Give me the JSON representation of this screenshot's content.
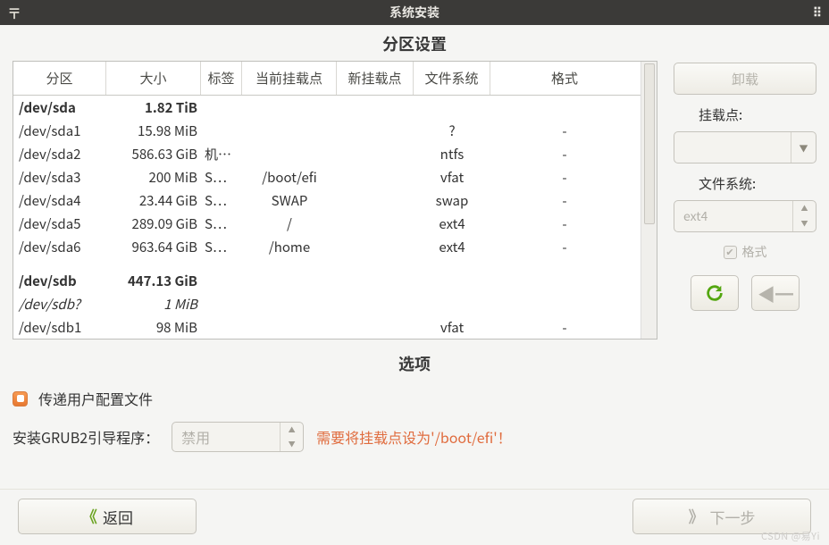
{
  "titlebar": {
    "title": "系统安装"
  },
  "section_partition_title": "分区设置",
  "columns": [
    "分区",
    "大小",
    "标签",
    "当前挂载点",
    "新挂载点",
    "文件系统",
    "格式"
  ],
  "rows": [
    {
      "part": "/dev/sda",
      "size": "1.82 TiB",
      "label": "",
      "cur": "",
      "new": "",
      "fs": "",
      "fmt": "",
      "style": "bold"
    },
    {
      "part": "/dev/sda1",
      "size": "15.98 MiB",
      "label": "",
      "cur": "",
      "new": "",
      "fs": "?",
      "fmt": "-"
    },
    {
      "part": "/dev/sda2",
      "size": "586.63 GiB",
      "label": "机…",
      "cur": "",
      "new": "",
      "fs": "ntfs",
      "fmt": "-"
    },
    {
      "part": "/dev/sda3",
      "size": "200 MiB",
      "label": "S…",
      "cur": "/boot/efi",
      "new": "",
      "fs": "vfat",
      "fmt": "-"
    },
    {
      "part": "/dev/sda4",
      "size": "23.44 GiB",
      "label": "S…",
      "cur": "SWAP",
      "new": "",
      "fs": "swap",
      "fmt": "-"
    },
    {
      "part": "/dev/sda5",
      "size": "289.09 GiB",
      "label": "S…",
      "cur": "/",
      "new": "",
      "fs": "ext4",
      "fmt": "-"
    },
    {
      "part": "/dev/sda6",
      "size": "963.64 GiB",
      "label": "S…",
      "cur": "/home",
      "new": "",
      "fs": "ext4",
      "fmt": "-"
    },
    {
      "part": "",
      "size": "",
      "label": "",
      "cur": "",
      "new": "",
      "fs": "",
      "fmt": "",
      "style": "gap"
    },
    {
      "part": "/dev/sdb",
      "size": "447.13 GiB",
      "label": "",
      "cur": "",
      "new": "",
      "fs": "",
      "fmt": "",
      "style": "bold"
    },
    {
      "part": "/dev/sdb?",
      "size": "1 MiB",
      "label": "",
      "cur": "",
      "new": "",
      "fs": "",
      "fmt": "",
      "style": "italic"
    },
    {
      "part": "/dev/sdb1",
      "size": "98 MiB",
      "label": "",
      "cur": "",
      "new": "",
      "fs": "vfat",
      "fmt": "-"
    }
  ],
  "side": {
    "unmount_label": "卸载",
    "mountpoint_label": "挂载点:",
    "mountpoint_value": "",
    "fs_label": "文件系统:",
    "fs_value": "ext4",
    "format_label": "格式"
  },
  "section_options_title": "选项",
  "opt_transfer_label": "传递用户配置文件",
  "grub_label": "安装GRUB2引导程序：",
  "grub_value": "禁用",
  "grub_warning": "需要将挂载点设为'/boot/efi'！",
  "footer": {
    "back": "返回",
    "next": "下一步"
  },
  "watermark": "CSDN @易Yi"
}
